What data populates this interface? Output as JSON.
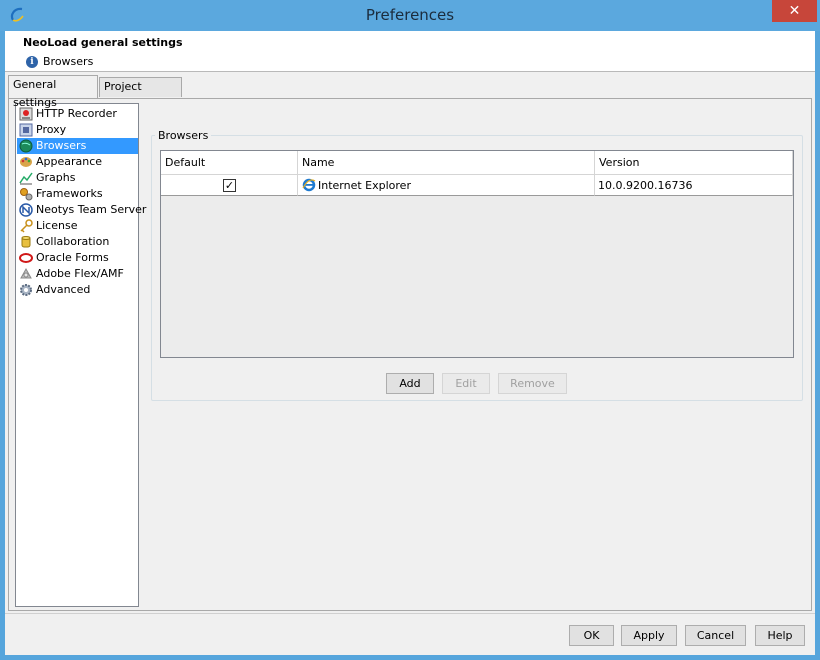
{
  "window": {
    "title": "Preferences",
    "close_glyph": "✕",
    "logo_icon": "neoload-logo-icon",
    "accent_color": "#5ba8de"
  },
  "header": {
    "title": "NeoLoad general settings",
    "subtitle": "Browsers",
    "subtitle_icon": "info-icon"
  },
  "tabs": [
    {
      "label": "General settings",
      "active": true
    },
    {
      "label": "Project settings",
      "active": false
    }
  ],
  "nav": {
    "items": [
      {
        "label": "HTTP Recorder",
        "icon": "recorder-icon",
        "selected": false
      },
      {
        "label": "Proxy",
        "icon": "proxy-icon",
        "selected": false
      },
      {
        "label": "Browsers",
        "icon": "globe-icon",
        "selected": true
      },
      {
        "label": "Appearance",
        "icon": "palette-icon",
        "selected": false
      },
      {
        "label": "Graphs",
        "icon": "graph-icon",
        "selected": false
      },
      {
        "label": "Frameworks",
        "icon": "gears-icon",
        "selected": false
      },
      {
        "label": "Neotys Team Server",
        "icon": "team-server-icon",
        "selected": false
      },
      {
        "label": "License",
        "icon": "key-icon",
        "selected": false
      },
      {
        "label": "Collaboration",
        "icon": "database-icon",
        "selected": false
      },
      {
        "label": "Oracle Forms",
        "icon": "oracle-icon",
        "selected": false
      },
      {
        "label": "Adobe Flex/AMF",
        "icon": "flex-icon",
        "selected": false
      },
      {
        "label": "Advanced",
        "icon": "gear-icon",
        "selected": false
      }
    ]
  },
  "browsers": {
    "group_title": "Browsers",
    "columns": [
      "Default",
      "Name",
      "Version"
    ],
    "rows": [
      {
        "default": true,
        "name": "Internet Explorer",
        "version": "10.0.9200.16736",
        "icon": "ie-icon"
      }
    ],
    "buttons": {
      "add": "Add",
      "edit": "Edit",
      "remove": "Remove"
    }
  },
  "footer": {
    "ok": "OK",
    "apply": "Apply",
    "cancel": "Cancel",
    "help": "Help"
  }
}
